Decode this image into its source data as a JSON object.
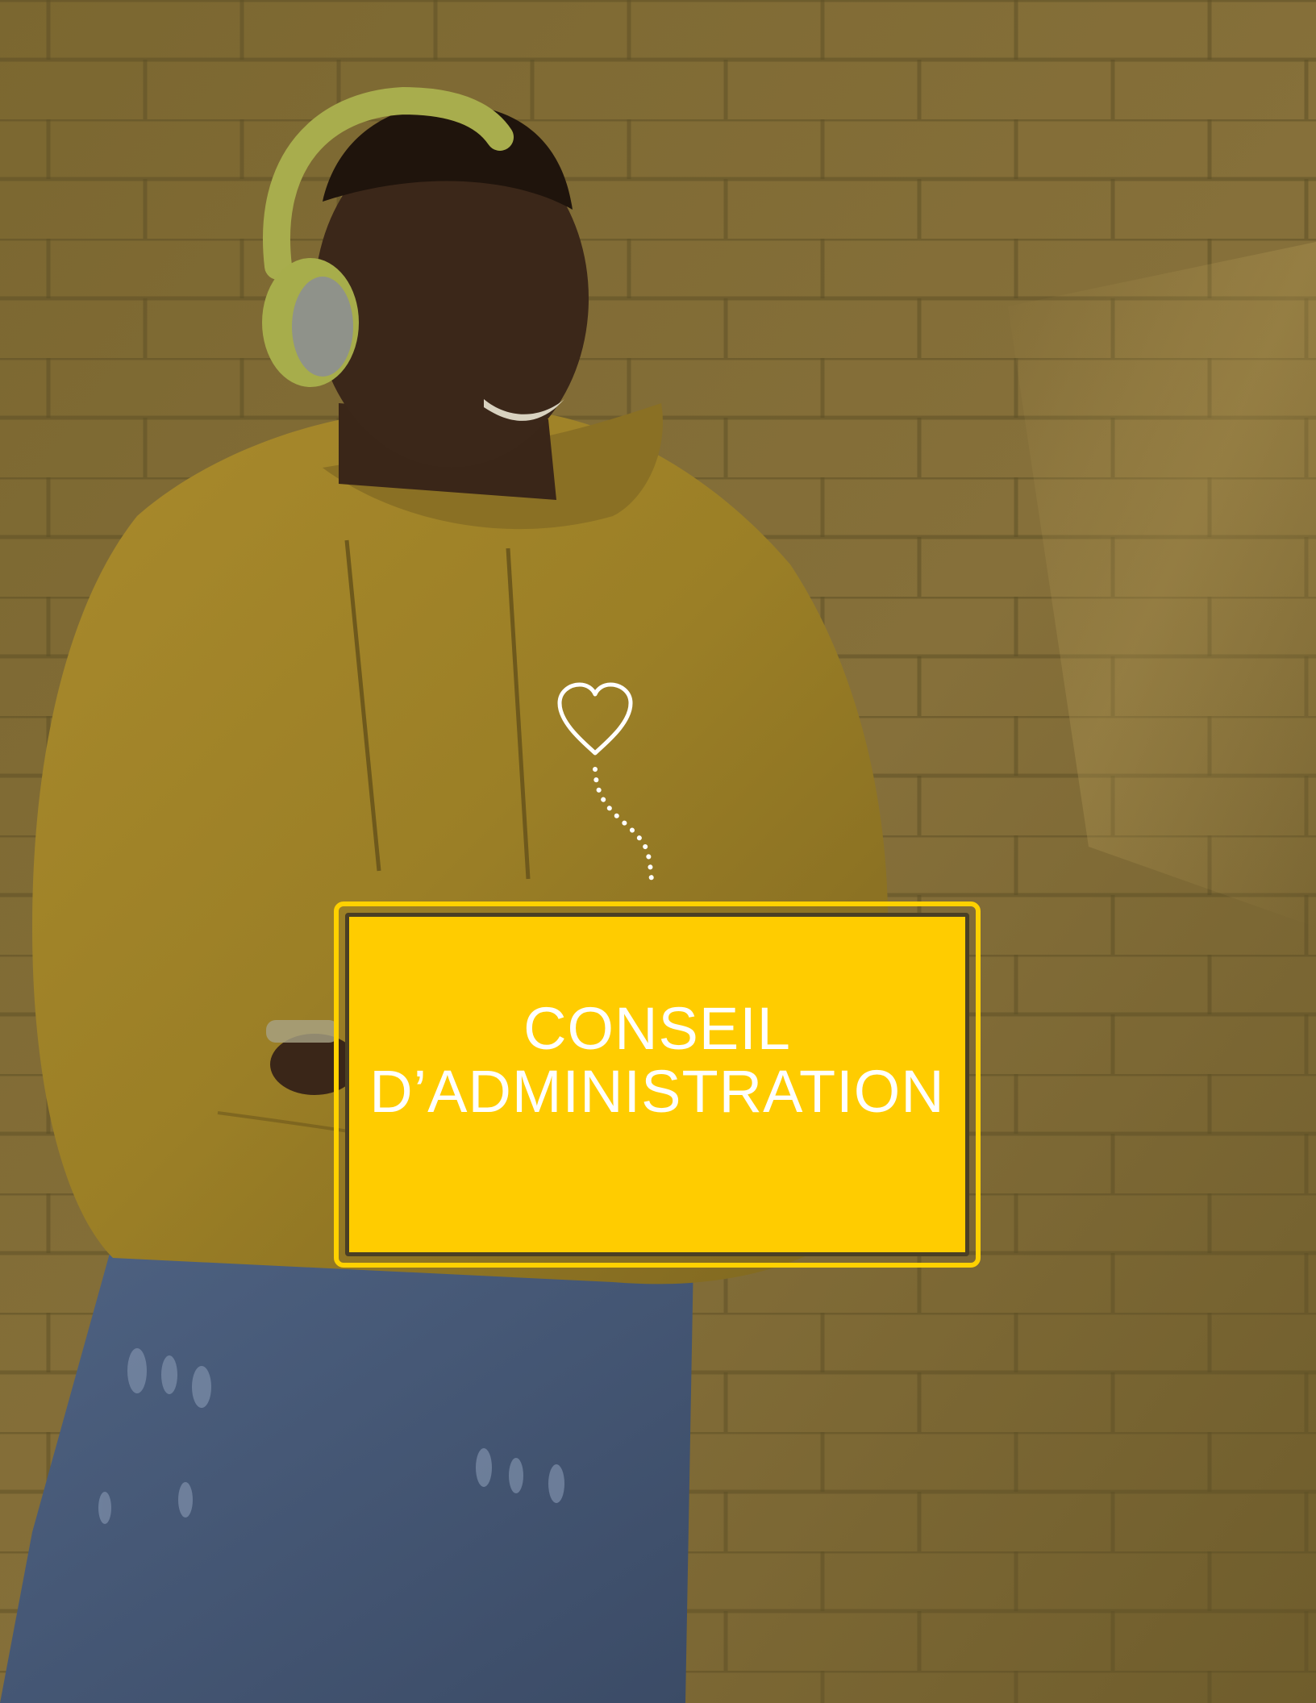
{
  "cover": {
    "title_line1": "CONSEIL",
    "title_line2": "D’ADMINISTRATION"
  },
  "photo": {
    "subject": "smiling man in yellow hoodie with headphones against yellow brick wall"
  },
  "icons": {
    "heart": "heart-outline-icon",
    "dotted_path": "dotted-line"
  },
  "colors": {
    "accent": "#ffcc00",
    "border": "#ffd100",
    "text": "#ffffff",
    "overlay": "#7f6a34"
  }
}
